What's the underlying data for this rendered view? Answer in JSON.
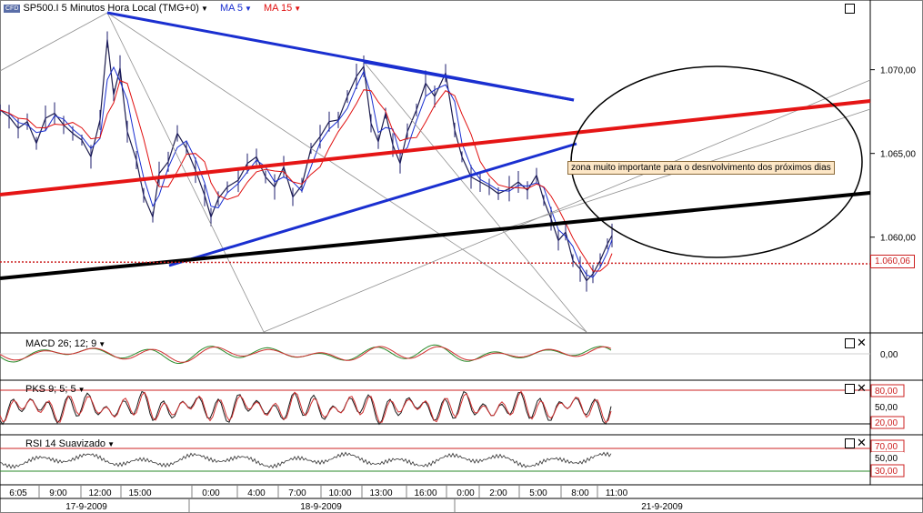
{
  "header": {
    "logo_text": "CFD",
    "instrument": "SP500.I 5 Minutos Hora Local (TMG+0)",
    "ma_fast": "MA 5",
    "ma_slow": "MA 15"
  },
  "annotation": "zona muito importante para o desnvolvimento dos próximos dias",
  "price_label": "1.060,06",
  "colors": {
    "ma_fast": "#1a2fd0",
    "ma_slow": "#e01010",
    "support": "#000000",
    "mid_line": "#e51515"
  },
  "panels": {
    "macd": {
      "label": "MACD 26; 12; 9",
      "ticks": [
        "0,00"
      ]
    },
    "pks": {
      "label": "PKS 9; 5; 5",
      "ticks": [
        "80,00",
        "50,00",
        "20,00"
      ]
    },
    "rsi": {
      "label": "RSI 14 Suavizado",
      "ticks": [
        "70,00",
        "50,00",
        "30,00"
      ]
    }
  },
  "chart_data": {
    "type": "line",
    "y_ticks": [
      "1.070,00",
      "1.065,00",
      "1.060,00"
    ],
    "ylim": [
      1054.5,
      1074
    ],
    "time_labels": [
      "6:05",
      "9:00",
      "12:00",
      "15:00",
      "0:00",
      "4:00",
      "7:00",
      "10:00",
      "13:00",
      "16:00",
      "0:00",
      "2:00",
      "5:00",
      "8:00",
      "11:00"
    ],
    "date_labels": [
      "17-9-2009",
      "18-9-2009",
      "21-9-2009"
    ],
    "price_path": [
      [
        0,
        1067.6
      ],
      [
        10,
        1067.2
      ],
      [
        20,
        1066.5
      ],
      [
        30,
        1066.9
      ],
      [
        40,
        1065.6
      ],
      [
        50,
        1067.1
      ],
      [
        60,
        1067.4
      ],
      [
        70,
        1066.7
      ],
      [
        80,
        1066.2
      ],
      [
        90,
        1065.8
      ],
      [
        100,
        1064.8
      ],
      [
        110,
        1067.0
      ],
      [
        118,
        1071.8
      ],
      [
        125,
        1068.5
      ],
      [
        132,
        1070.1
      ],
      [
        140,
        1066.3
      ],
      [
        150,
        1064.6
      ],
      [
        158,
        1062.5
      ],
      [
        168,
        1061.2
      ],
      [
        175,
        1063.8
      ],
      [
        185,
        1064.5
      ],
      [
        195,
        1066.2
      ],
      [
        205,
        1065.3
      ],
      [
        215,
        1064.0
      ],
      [
        225,
        1062.5
      ],
      [
        232,
        1061.2
      ],
      [
        240,
        1062.3
      ],
      [
        250,
        1063.0
      ],
      [
        262,
        1063.4
      ],
      [
        272,
        1064.4
      ],
      [
        282,
        1064.8
      ],
      [
        292,
        1063.6
      ],
      [
        302,
        1063.0
      ],
      [
        312,
        1064.2
      ],
      [
        322,
        1062.4
      ],
      [
        332,
        1063.1
      ],
      [
        342,
        1065.3
      ],
      [
        352,
        1066.0
      ],
      [
        362,
        1066.9
      ],
      [
        372,
        1067.0
      ],
      [
        382,
        1068.4
      ],
      [
        392,
        1069.6
      ],
      [
        400,
        1070.2
      ],
      [
        408,
        1066.8
      ],
      [
        416,
        1065.7
      ],
      [
        424,
        1067.4
      ],
      [
        432,
        1065.5
      ],
      [
        440,
        1064.4
      ],
      [
        448,
        1066.3
      ],
      [
        458,
        1067.6
      ],
      [
        468,
        1069.2
      ],
      [
        478,
        1068.4
      ],
      [
        490,
        1069.8
      ],
      [
        500,
        1066.4
      ],
      [
        508,
        1064.8
      ],
      [
        518,
        1063.6
      ],
      [
        528,
        1063.3
      ],
      [
        538,
        1063.0
      ],
      [
        548,
        1062.6
      ],
      [
        560,
        1062.9
      ],
      [
        570,
        1063.3
      ],
      [
        580,
        1062.8
      ],
      [
        590,
        1063.7
      ],
      [
        598,
        1062.2
      ],
      [
        606,
        1061.1
      ],
      [
        614,
        1059.8
      ],
      [
        622,
        1060.3
      ],
      [
        630,
        1058.6
      ],
      [
        638,
        1058.1
      ],
      [
        645,
        1057.4
      ],
      [
        652,
        1057.8
      ],
      [
        660,
        1058.6
      ],
      [
        668,
        1059.6
      ],
      [
        673,
        1060.1
      ]
    ]
  }
}
